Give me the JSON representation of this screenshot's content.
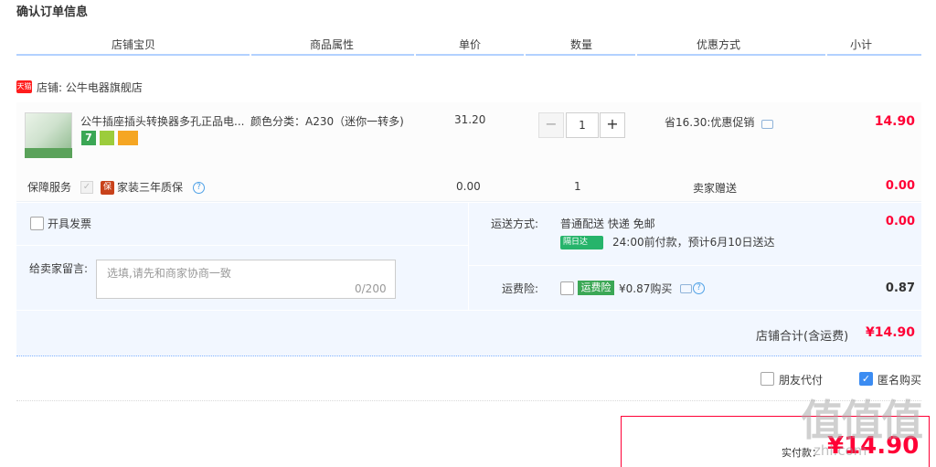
{
  "page_title": "确认订单信息",
  "columns": [
    "店铺宝贝",
    "商品属性",
    "单价",
    "数量",
    "优惠方式",
    "小计"
  ],
  "shop": {
    "badge": "天猫",
    "label": "店铺: 公牛电器旗舰店"
  },
  "item": {
    "title": "公牛插座插头转换器多孔正品电...",
    "badges": [
      "7",
      "",
      ""
    ],
    "sku": "颜色分类：A230（迷你一转多)",
    "unit_price": "31.20",
    "qty_minus": "−",
    "qty_value": "1",
    "qty_plus": "+",
    "promo": "省16.30:优惠促销",
    "subtotal": "14.90"
  },
  "service": {
    "label": "保障服务",
    "check": "✓",
    "icon_text": "保",
    "name": "家装三年质保",
    "help": "?",
    "price": "0.00",
    "qty": "1",
    "gift": "卖家赠送",
    "total": "0.00"
  },
  "invoice": {
    "label": "开具发票"
  },
  "message": {
    "label": "给卖家留言:",
    "placeholder": "选填,请先和商家协商一致",
    "counter": "0/200"
  },
  "shipping": {
    "label": "运送方式:",
    "method": "普通配送 快递 免邮",
    "badge": "隔日达",
    "note": "24:00前付款，预计6月10日送达",
    "cost": "0.00"
  },
  "insurance": {
    "label": "运费险:",
    "badge": "运费险",
    "text": "¥0.87购买",
    "cost": "0.87"
  },
  "shop_total": {
    "label": "店铺合计(含运费)",
    "value": "¥14.90"
  },
  "options": {
    "friend_pay": "朋友代付",
    "anonymous": "匿名购买",
    "check": "✓"
  },
  "payment": {
    "label": "实付款：",
    "amount": "¥14.90"
  },
  "watermark": {
    "text": "值值值",
    "sub": "zhi.com"
  },
  "colors": {
    "price_red": "#ff0036",
    "area_blue": "#f2f7ff",
    "header_line": "#b2d1ff",
    "check_blue": "#3b8cf2"
  }
}
